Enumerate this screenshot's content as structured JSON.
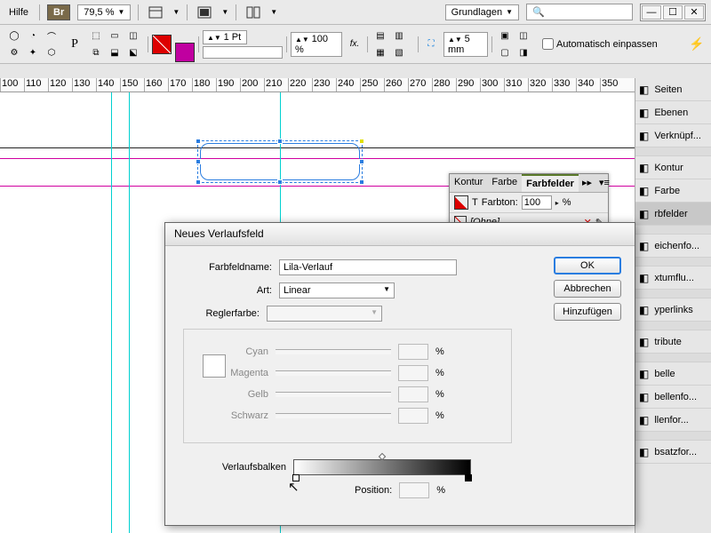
{
  "menu": {
    "help": "Hilfe",
    "br": "Br",
    "zoom": "79,5 %",
    "workspace": "Grundlagen"
  },
  "toolbar": {
    "stroke_pt": "1 Pt",
    "opacity": "100 %",
    "spacing": "5 mm",
    "autofit_checkbox": "Automatisch einpassen"
  },
  "ruler": [
    "100",
    "110",
    "120",
    "130",
    "140",
    "150",
    "160",
    "170",
    "180",
    "190",
    "200",
    "210",
    "220",
    "230",
    "240",
    "250",
    "260",
    "270",
    "280",
    "290",
    "300",
    "310",
    "320",
    "330",
    "340",
    "350"
  ],
  "right_panel": [
    "Seiten",
    "Ebenen",
    "Verknüpf...",
    "",
    "Kontur",
    "Farbe",
    "rbfelder",
    "",
    "eichenfo...",
    "",
    "xtumflu...",
    "",
    "yperlinks",
    "",
    "tribute",
    "",
    "belle",
    "bellenfo...",
    "llenfor...",
    "",
    "bsatzfor..."
  ],
  "swatches_panel": {
    "tabs": [
      "Kontur",
      "Farbe",
      "Farbfelder"
    ],
    "tint_label": "Farbton:",
    "tint_value": "100",
    "tint_unit": "%",
    "none_label": "[Ohne]"
  },
  "dialog": {
    "title": "Neues Verlaufsfeld",
    "name_label": "Farbfeldname:",
    "name_value": "Lila-Verlauf",
    "type_label": "Art:",
    "type_value": "Linear",
    "stopcolor_label": "Reglerfarbe:",
    "cmyk": {
      "cyan": "Cyan",
      "magenta": "Magenta",
      "yellow": "Gelb",
      "black": "Schwarz",
      "pct": "%"
    },
    "ramp_label": "Verlaufsbalken",
    "position_label": "Position:",
    "position_unit": "%",
    "ok": "OK",
    "cancel": "Abbrechen",
    "add": "Hinzufügen"
  }
}
